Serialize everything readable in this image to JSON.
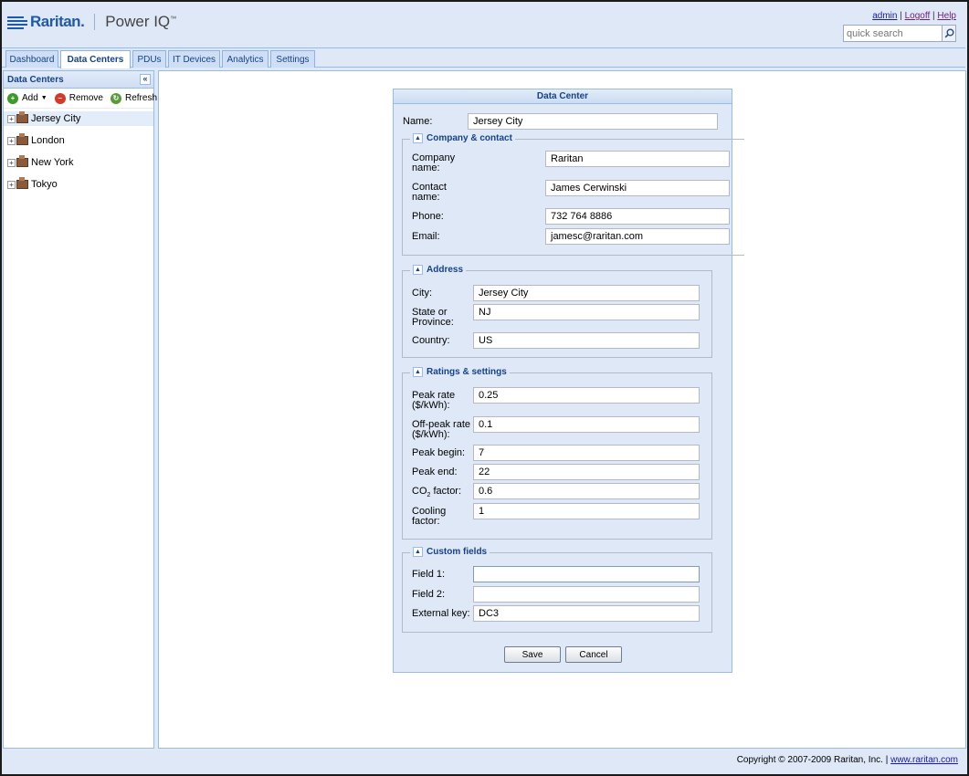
{
  "header": {
    "brand": "Raritan.",
    "product": "Power IQ",
    "trademark": "™",
    "links": {
      "admin": "admin",
      "sep1": "|",
      "logoff": "Logoff",
      "sep2": "|",
      "help": "Help"
    },
    "search_placeholder": "quick search"
  },
  "tabs": [
    {
      "label": "Dashboard",
      "active": false
    },
    {
      "label": "Data Centers",
      "active": true
    },
    {
      "label": "PDUs",
      "active": false
    },
    {
      "label": "IT Devices",
      "active": false
    },
    {
      "label": "Analytics",
      "active": false
    },
    {
      "label": "Settings",
      "active": false
    }
  ],
  "sidebar": {
    "title": "Data Centers",
    "toolbar": {
      "add": "Add",
      "remove": "Remove",
      "refresh": "Refresh"
    },
    "items": [
      {
        "label": "Jersey City",
        "selected": true
      },
      {
        "label": "London"
      },
      {
        "label": "New York"
      },
      {
        "label": "Tokyo"
      }
    ]
  },
  "form": {
    "title": "Data Center",
    "name_label": "Name:",
    "name_value": "Jersey City",
    "company": {
      "legend": "Company & contact",
      "company_label_1": "Company",
      "company_label_2": "name:",
      "company_value": "Raritan",
      "contact_label_1": "Contact",
      "contact_label_2": "name:",
      "contact_value": "James Cerwinski",
      "phone_label": "Phone:",
      "phone_value": "732 764 8886",
      "email_label": "Email:",
      "email_value": "jamesc@raritan.com"
    },
    "address": {
      "legend": "Address",
      "city_label": "City:",
      "city_value": "Jersey City",
      "state_label_1": "State or",
      "state_label_2": "Province:",
      "state_value": "NJ",
      "country_label": "Country:",
      "country_value": "US"
    },
    "ratings": {
      "legend": "Ratings & settings",
      "peak_rate_label_1": "Peak rate",
      "peak_rate_label_2": "($/kWh):",
      "peak_rate_value": "0.25",
      "offpeak_label_1": "Off-peak rate",
      "offpeak_label_2": "($/kWh):",
      "offpeak_value": "0.1",
      "peak_begin_label": "Peak begin:",
      "peak_begin_value": "7",
      "peak_end_label": "Peak end:",
      "peak_end_value": "22",
      "co2_label_a": "CO",
      "co2_label_sub": "2",
      "co2_label_b": " factor:",
      "co2_value": "0.6",
      "cooling_label_1": "Cooling",
      "cooling_label_2": "factor:",
      "cooling_value": "1"
    },
    "custom": {
      "legend": "Custom fields",
      "field1_label": "Field 1:",
      "field1_value": "",
      "field2_label": "Field 2:",
      "field2_value": "",
      "extkey_label": "External key:",
      "extkey_value": "DC3"
    },
    "save_label": "Save",
    "cancel_label": "Cancel"
  },
  "footer": {
    "copyright": "Copyright © 2007-2009 Raritan, Inc. |",
    "link": "www.raritan.com"
  },
  "colors": {
    "accent": "#15428b",
    "panel_bg": "#dfe8f6",
    "border": "#99bbe8"
  }
}
